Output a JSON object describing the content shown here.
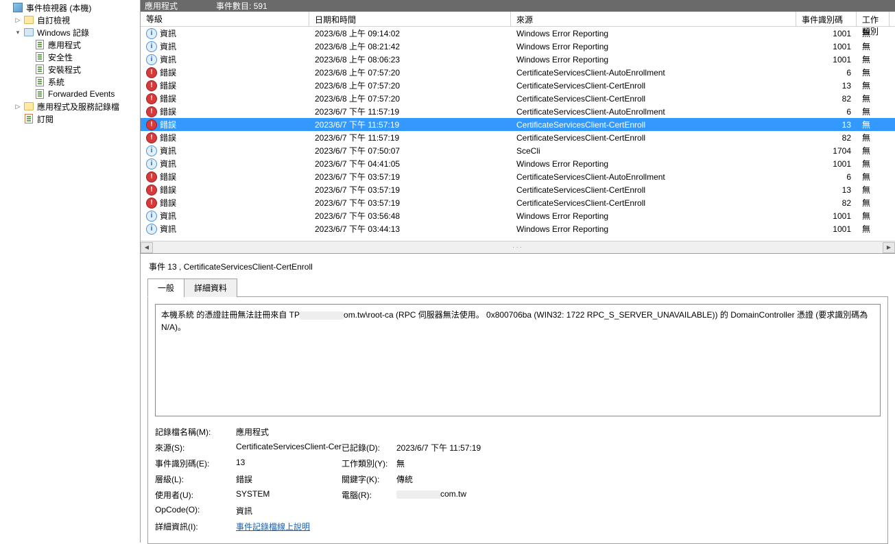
{
  "window_title": "事件檢視器 (本機)",
  "tree": {
    "root": "事件檢視器 (本機)",
    "custom_views": "自訂檢視",
    "windows_logs": "Windows 記錄",
    "app": "應用程式",
    "security": "安全性",
    "setup": "安裝程式",
    "system": "系統",
    "forwarded": "Forwarded Events",
    "app_services": "應用程式及服務記錄檔",
    "subscriptions": "訂閱"
  },
  "header": {
    "log_name": "應用程式",
    "count_label": "事件數目:",
    "count": "591"
  },
  "columns": {
    "level": "等級",
    "date": "日期和時間",
    "source": "來源",
    "id": "事件識別碼",
    "cat": "工作類別"
  },
  "levels": {
    "info": "資訊",
    "error": "錯誤"
  },
  "events": [
    {
      "lvl": "info",
      "date": "2023/6/8 上午 09:14:02",
      "src": "Windows Error Reporting",
      "id": "1001",
      "cat": "無"
    },
    {
      "lvl": "info",
      "date": "2023/6/8 上午 08:21:42",
      "src": "Windows Error Reporting",
      "id": "1001",
      "cat": "無"
    },
    {
      "lvl": "info",
      "date": "2023/6/8 上午 08:06:23",
      "src": "Windows Error Reporting",
      "id": "1001",
      "cat": "無"
    },
    {
      "lvl": "error",
      "date": "2023/6/8 上午 07:57:20",
      "src": "CertificateServicesClient-AutoEnrollment",
      "id": "6",
      "cat": "無"
    },
    {
      "lvl": "error",
      "date": "2023/6/8 上午 07:57:20",
      "src": "CertificateServicesClient-CertEnroll",
      "id": "13",
      "cat": "無"
    },
    {
      "lvl": "error",
      "date": "2023/6/8 上午 07:57:20",
      "src": "CertificateServicesClient-CertEnroll",
      "id": "82",
      "cat": "無"
    },
    {
      "lvl": "error",
      "date": "2023/6/7 下午 11:57:19",
      "src": "CertificateServicesClient-AutoEnrollment",
      "id": "6",
      "cat": "無"
    },
    {
      "lvl": "error",
      "date": "2023/6/7 下午 11:57:19",
      "src": "CertificateServicesClient-CertEnroll",
      "id": "13",
      "cat": "無",
      "selected": true
    },
    {
      "lvl": "error",
      "date": "2023/6/7 下午 11:57:19",
      "src": "CertificateServicesClient-CertEnroll",
      "id": "82",
      "cat": "無"
    },
    {
      "lvl": "info",
      "date": "2023/6/7 下午 07:50:07",
      "src": "SceCli",
      "id": "1704",
      "cat": "無"
    },
    {
      "lvl": "info",
      "date": "2023/6/7 下午 04:41:05",
      "src": "Windows Error Reporting",
      "id": "1001",
      "cat": "無"
    },
    {
      "lvl": "error",
      "date": "2023/6/7 下午 03:57:19",
      "src": "CertificateServicesClient-AutoEnrollment",
      "id": "6",
      "cat": "無"
    },
    {
      "lvl": "error",
      "date": "2023/6/7 下午 03:57:19",
      "src": "CertificateServicesClient-CertEnroll",
      "id": "13",
      "cat": "無"
    },
    {
      "lvl": "error",
      "date": "2023/6/7 下午 03:57:19",
      "src": "CertificateServicesClient-CertEnroll",
      "id": "82",
      "cat": "無"
    },
    {
      "lvl": "info",
      "date": "2023/6/7 下午 03:56:48",
      "src": "Windows Error Reporting",
      "id": "1001",
      "cat": "無"
    },
    {
      "lvl": "info",
      "date": "2023/6/7 下午 03:44:13",
      "src": "Windows Error Reporting",
      "id": "1001",
      "cat": "無"
    }
  ],
  "detail": {
    "title_prefix": "事件 ",
    "title_id": "13",
    "title_sep": " , ",
    "title_src": "CertificateServicesClient-CertEnroll",
    "tab_general": "一般",
    "tab_details": "詳細資料",
    "message_p1": "本機系統 的憑證註冊無法註冊來自 TP",
    "message_p2": "om.tw\\root-ca (RPC 伺服器無法使用。 0x800706ba (WIN32: 1722 RPC_S_SERVER_UNAVAILABLE)) 的 DomainController 憑證 (要求識別碼為 N/A)。",
    "labels": {
      "log_name": "記錄檔名稱(M):",
      "source": "來源(S):",
      "event_id": "事件識別碼(E):",
      "level": "層級(L):",
      "user": "使用者(U):",
      "opcode": "OpCode(O):",
      "more": "詳細資訊(I):",
      "logged": "已記錄(D):",
      "category": "工作類別(Y):",
      "keywords": "關鍵字(K):",
      "computer": "電腦(R):"
    },
    "values": {
      "log_name": "應用程式",
      "source": "CertificateServicesClient-Cer",
      "event_id": "13",
      "level": "錯誤",
      "user": "SYSTEM",
      "opcode": "資訊",
      "more_link": "事件記錄檔線上說明",
      "logged": "2023/6/7 下午 11:57:19",
      "category": "無",
      "keywords": "傳統",
      "computer_suffix": "com.tw"
    }
  }
}
